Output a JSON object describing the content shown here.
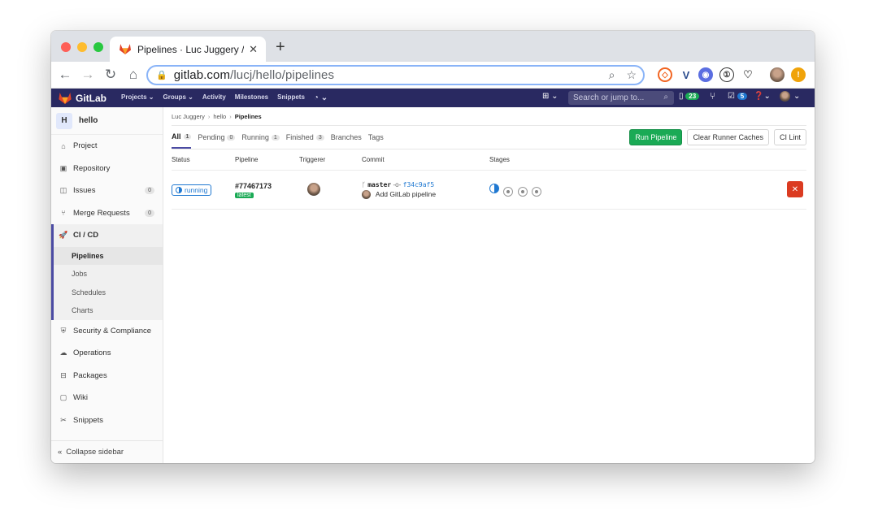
{
  "browser": {
    "tab_title": "Pipelines · Luc Juggery / hello",
    "url_host": "gitlab.com",
    "url_path": "/lucj/hello/pipelines"
  },
  "header": {
    "brand": "GitLab",
    "nav": [
      "Projects ⌄",
      "Groups ⌄",
      "Activity",
      "Milestones",
      "Snippets"
    ],
    "search_placeholder": "Search or jump to...",
    "issues_count": "23",
    "todos_count": "5"
  },
  "sidebar": {
    "project_initial": "H",
    "project_name": "hello",
    "items": [
      {
        "label": "Project",
        "icon": "home-icon"
      },
      {
        "label": "Repository",
        "icon": "book-icon"
      },
      {
        "label": "Issues",
        "icon": "issues-icon",
        "count": "0"
      },
      {
        "label": "Merge Requests",
        "icon": "merge-request-icon",
        "count": "0"
      }
    ],
    "cicd_label": "CI / CD",
    "cicd_sub": [
      "Pipelines",
      "Jobs",
      "Schedules",
      "Charts"
    ],
    "items_after": [
      {
        "label": "Security & Compliance",
        "icon": "shield-icon"
      },
      {
        "label": "Operations",
        "icon": "cloud-icon"
      },
      {
        "label": "Packages",
        "icon": "package-icon"
      },
      {
        "label": "Wiki",
        "icon": "book-open-icon"
      },
      {
        "label": "Snippets",
        "icon": "scissors-icon"
      }
    ],
    "collapse_label": "Collapse sidebar"
  },
  "breadcrumb": {
    "owner": "Luc Juggery",
    "project": "hello",
    "current": "Pipelines"
  },
  "tabs": [
    {
      "label": "All",
      "count": "1"
    },
    {
      "label": "Pending",
      "count": "0"
    },
    {
      "label": "Running",
      "count": "1"
    },
    {
      "label": "Finished",
      "count": "3"
    },
    {
      "label": "Branches"
    },
    {
      "label": "Tags"
    }
  ],
  "actions": {
    "run_pipeline": "Run Pipeline",
    "clear_caches": "Clear Runner Caches",
    "ci_lint": "CI Lint"
  },
  "table": {
    "headers": [
      "Status",
      "Pipeline",
      "Triggerer",
      "Commit",
      "Stages"
    ],
    "rows": [
      {
        "status": "running",
        "pipeline_id": "#77467173",
        "tag": "latest",
        "branch": "master",
        "sha": "f34c9af5",
        "message": "Add GitLab pipeline",
        "stages": [
          "running",
          "created",
          "created",
          "created"
        ]
      }
    ]
  },
  "colors": {
    "header_bg": "#292961",
    "accent": "#4b4ba3",
    "success": "#1aaa55",
    "running": "#1f78d1",
    "danger": "#db3b21"
  }
}
